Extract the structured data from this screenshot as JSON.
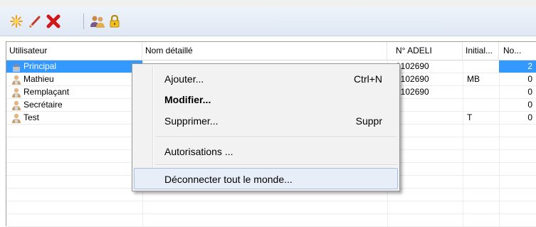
{
  "toolbar": {
    "buttons": [
      {
        "name": "new-icon"
      },
      {
        "name": "edit-icon"
      },
      {
        "name": "delete-icon"
      },
      {
        "name": "users-icon"
      },
      {
        "name": "lock-icon"
      }
    ]
  },
  "table": {
    "columns": [
      "Utilisateur",
      "Nom détaillé",
      "N° ADELI",
      "Initial...",
      "No..."
    ],
    "rows": [
      {
        "user": "Principal",
        "detail": "",
        "adeli": "0102690",
        "initial": "",
        "no": "2",
        "selected": true
      },
      {
        "user": "Mathieu",
        "detail": "",
        "adeli": "0102690",
        "initial": "MB",
        "no": "0"
      },
      {
        "user": "Remplaçant",
        "detail": "",
        "adeli": "0102690",
        "initial": "",
        "no": "0"
      },
      {
        "user": "Secrétaire",
        "detail": "",
        "adeli": "",
        "initial": "",
        "no": "0"
      },
      {
        "user": "Test",
        "detail": "",
        "adeli": "",
        "initial": "T",
        "no": "0"
      }
    ]
  },
  "context_menu": {
    "items": [
      {
        "label": "Ajouter...",
        "shortcut": "Ctrl+N"
      },
      {
        "label": "Modifier...",
        "shortcut": ""
      },
      {
        "label": "Supprimer...",
        "shortcut": "Suppr"
      },
      {
        "label": "Autorisations ...",
        "shortcut": ""
      },
      {
        "label": "Déconnecter tout le monde...",
        "shortcut": ""
      }
    ]
  },
  "colors": {
    "selection": "#3399ff",
    "toolbar": "#e3ebf6",
    "menu_highlight": "#e8eef7"
  }
}
